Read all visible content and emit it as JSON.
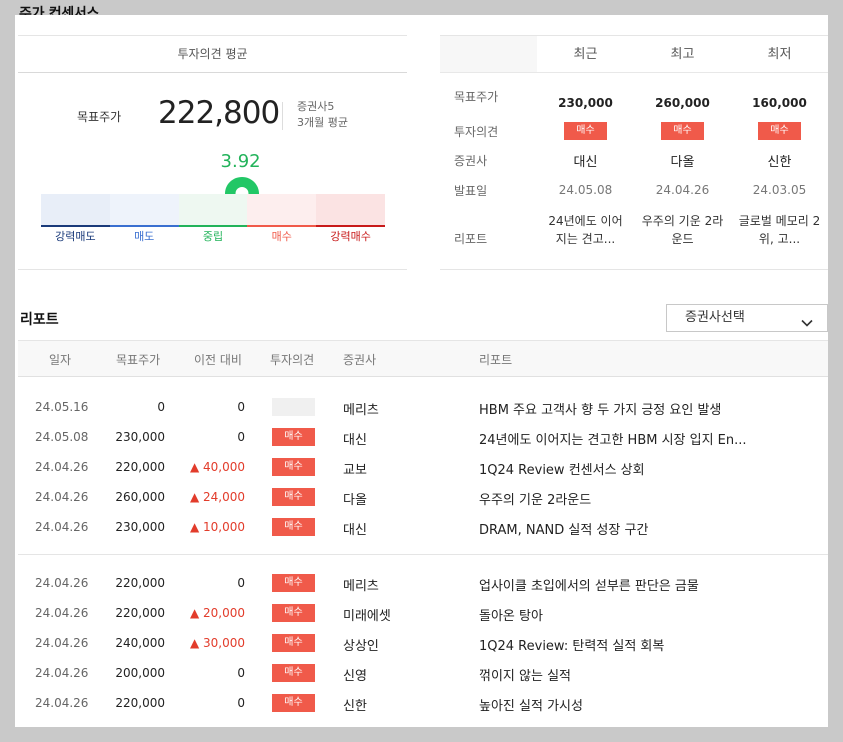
{
  "page_title": "주가 컨센서스",
  "average": {
    "header": "투자의견 평균",
    "target_label": "목표주가",
    "target_value": "222,800",
    "brokers": "증권사5",
    "period": "3개월 평균",
    "score": "3.92",
    "score_fraction": 0.583,
    "scale": [
      {
        "label": "강력매도",
        "color": "#1a3a7a",
        "bg": "#e8eef8"
      },
      {
        "label": "매도",
        "color": "#3a6fd0",
        "bg": "#eef3fb"
      },
      {
        "label": "중립",
        "color": "#22b35a",
        "bg": "#eef8f1"
      },
      {
        "label": "매수",
        "color": "#f05a4a",
        "bg": "#fdeeee"
      },
      {
        "label": "강력매수",
        "color": "#c81a1a",
        "bg": "#fbe3e3"
      }
    ],
    "pin_color": "#22c766"
  },
  "recent": {
    "columns": [
      "최근",
      "최고",
      "최저"
    ],
    "row_labels": [
      "목표주가",
      "투자의견",
      "증권사",
      "발표일",
      "리포트"
    ],
    "entries": [
      {
        "price": "230,000",
        "opinion": "매수",
        "broker": "대신",
        "date": "24.05.08",
        "report": "24년에도 이어지는 견고..."
      },
      {
        "price": "260,000",
        "opinion": "매수",
        "broker": "다올",
        "date": "24.04.26",
        "report": "우주의 기운 2라운드"
      },
      {
        "price": "160,000",
        "opinion": "매수",
        "broker": "신한",
        "date": "24.03.05",
        "report": "글로벌 메모리 2위, 고..."
      }
    ]
  },
  "reports": {
    "title": "리포트",
    "select_label": "증권사선택",
    "headers": {
      "date": "일자",
      "target": "목표주가",
      "prev": "이전 대비",
      "opinion": "투자의견",
      "broker": "증권사",
      "report": "리포트"
    },
    "rows": [
      {
        "date": "24.05.16",
        "target": "0",
        "prev": "0",
        "up": false,
        "opinion": "",
        "broker": "메리츠",
        "report": "HBM 주요 고객사 향 두 가지 긍정 요인 발생"
      },
      {
        "date": "24.05.08",
        "target": "230,000",
        "prev": "0",
        "up": false,
        "opinion": "매수",
        "broker": "대신",
        "report": "24년에도 이어지는 견고한 HBM 시장 입지 En..."
      },
      {
        "date": "24.04.26",
        "target": "220,000",
        "prev": "▲ 40,000",
        "up": true,
        "opinion": "매수",
        "broker": "교보",
        "report": "1Q24 Review 컨센서스 상회"
      },
      {
        "date": "24.04.26",
        "target": "260,000",
        "prev": "▲ 24,000",
        "up": true,
        "opinion": "매수",
        "broker": "다올",
        "report": "우주의 기운 2라운드"
      },
      {
        "date": "24.04.26",
        "target": "230,000",
        "prev": "▲ 10,000",
        "up": true,
        "opinion": "매수",
        "broker": "대신",
        "report": "DRAM, NAND 실적 성장 구간"
      },
      {
        "date": "24.04.26",
        "target": "220,000",
        "prev": "0",
        "up": false,
        "opinion": "매수",
        "broker": "메리츠",
        "report": "업사이클 초입에서의 섣부른 판단은 금물"
      },
      {
        "date": "24.04.26",
        "target": "220,000",
        "prev": "▲ 20,000",
        "up": true,
        "opinion": "매수",
        "broker": "미래에셋",
        "report": "돌아온 탕아"
      },
      {
        "date": "24.04.26",
        "target": "240,000",
        "prev": "▲ 30,000",
        "up": true,
        "opinion": "매수",
        "broker": "상상인",
        "report": "1Q24 Review: 탄력적 실적 회복"
      },
      {
        "date": "24.04.26",
        "target": "200,000",
        "prev": "0",
        "up": false,
        "opinion": "매수",
        "broker": "신영",
        "report": "꺾이지 않는 실적"
      },
      {
        "date": "24.04.26",
        "target": "220,000",
        "prev": "0",
        "up": false,
        "opinion": "매수",
        "broker": "신한",
        "report": "높아진 실적 가시성"
      }
    ]
  }
}
